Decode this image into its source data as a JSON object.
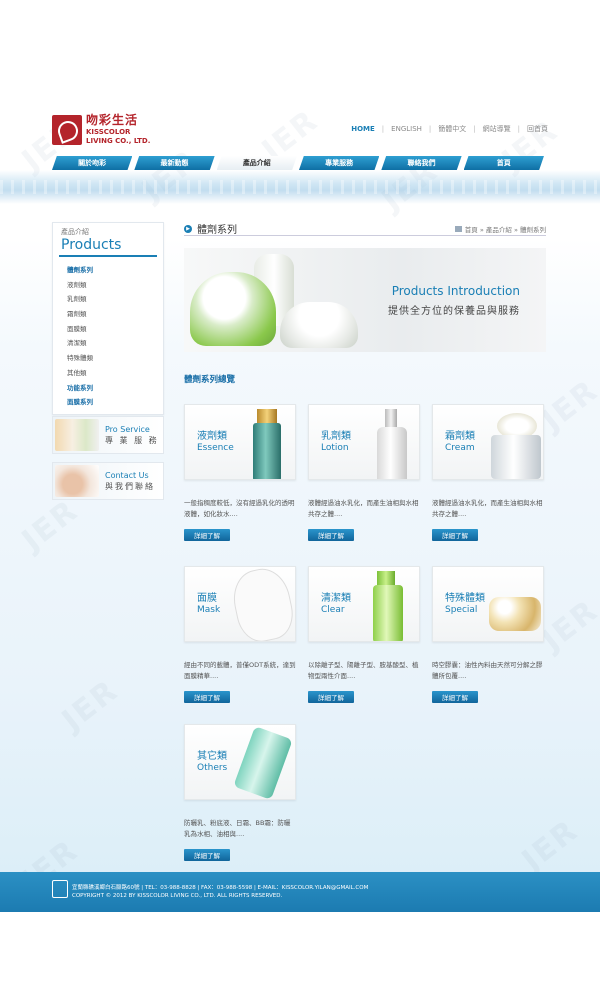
{
  "brand": {
    "name_cn": "吻彩生活",
    "name_en_line1": "KISSCOLOR",
    "name_en_line2": "LIVING CO., LTD."
  },
  "topnav": [
    "HOME",
    "ENGLISH",
    "簡體中文",
    "網站導覽",
    "回首頁"
  ],
  "mainnav": [
    "關於吻彩",
    "最新動態",
    "產品介紹",
    "專業服務",
    "聯絡我們",
    "首頁"
  ],
  "sidebar": {
    "title_cn": "產品介紹",
    "title_en": "Products",
    "items": [
      {
        "label": "體劑系列"
      },
      {
        "label": "液劑類"
      },
      {
        "label": "乳劑類"
      },
      {
        "label": "霜劑類"
      },
      {
        "label": "面膜類"
      },
      {
        "label": "清潔類"
      },
      {
        "label": "特殊體類"
      },
      {
        "label": "其他類"
      },
      {
        "label": "功能系列"
      },
      {
        "label": "面膜系列"
      }
    ]
  },
  "promos": [
    {
      "en": "Pro Service",
      "cn": "專 業 服 務"
    },
    {
      "en": "Contact Us",
      "cn": "與我們聯絡"
    }
  ],
  "content": {
    "page_title": "體劑系列",
    "breadcrumb": "首頁 » 產品介紹 » 體劑系列",
    "banner_en": "Products Introduction",
    "banner_cn": "提供全方位的保養品與服務",
    "section_title": "體劑系列總覽"
  },
  "products": [
    {
      "cn": "液劑類",
      "en": "Essence",
      "desc": "一般指稠度較低，沒有經過乳化的透明液體，如化妝水....",
      "button": "詳細了解"
    },
    {
      "cn": "乳劑類",
      "en": "Lotion",
      "desc": "液體經過油水乳化，而產生油相與水相共存之體....",
      "button": "詳細了解"
    },
    {
      "cn": "霜劑類",
      "en": "Cream",
      "desc": "液體經過油水乳化，而產生油相與水相共存之體....",
      "button": "詳細了解"
    },
    {
      "cn": "面膜",
      "en": "Mask",
      "desc": "經由不同的載體，普僅ODT系統，達到面膜精華....",
      "button": "詳細了解"
    },
    {
      "cn": "清潔類",
      "en": "Clear",
      "desc": "以除離子型、陽離子型、胺基酸型、植物型兩性介面....",
      "button": "詳細了解"
    },
    {
      "cn": "特殊體類",
      "en": "Special",
      "desc": "時空膠囊：油性內料由天然可分解之膠體所包覆....",
      "button": "詳細了解"
    },
    {
      "cn": "其它類",
      "en": "Others",
      "desc": "防曬乳、粉底液、日霜、BB霜：防曬乳為水相、油相與....",
      "button": "詳細了解"
    }
  ],
  "footer": {
    "line1": "宜蘭縣礁溪鄉白石腳路60號 | TEL：03-988-8828 | FAX：03-988-5598 | E-MAIL：KISSCOLOR.YILAN@GMAIL.COM",
    "line2": "COPYRIGHT © 2012 BY KISSCOLOR LIVING CO., LTD. ALL RIGHTS RESERVED."
  }
}
